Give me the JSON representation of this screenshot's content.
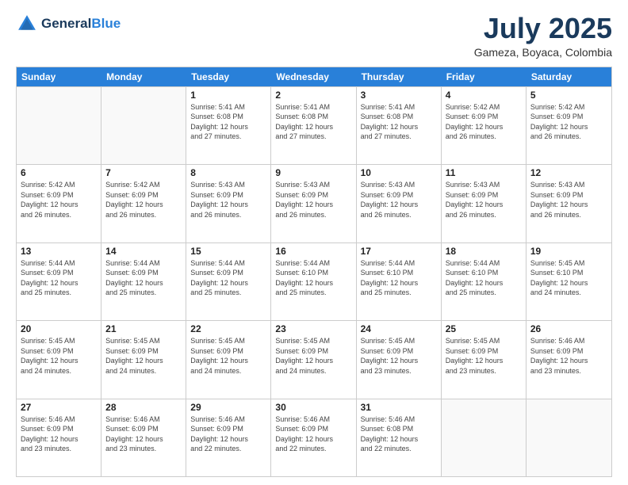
{
  "header": {
    "logo_line1": "General",
    "logo_line2": "Blue",
    "month_year": "July 2025",
    "location": "Gameza, Boyaca, Colombia"
  },
  "days_of_week": [
    "Sunday",
    "Monday",
    "Tuesday",
    "Wednesday",
    "Thursday",
    "Friday",
    "Saturday"
  ],
  "weeks": [
    [
      {
        "day": "",
        "empty": true,
        "info": ""
      },
      {
        "day": "",
        "empty": true,
        "info": ""
      },
      {
        "day": "1",
        "info": "Sunrise: 5:41 AM\nSunset: 6:08 PM\nDaylight: 12 hours\nand 27 minutes."
      },
      {
        "day": "2",
        "info": "Sunrise: 5:41 AM\nSunset: 6:08 PM\nDaylight: 12 hours\nand 27 minutes."
      },
      {
        "day": "3",
        "info": "Sunrise: 5:41 AM\nSunset: 6:08 PM\nDaylight: 12 hours\nand 27 minutes."
      },
      {
        "day": "4",
        "info": "Sunrise: 5:42 AM\nSunset: 6:09 PM\nDaylight: 12 hours\nand 26 minutes."
      },
      {
        "day": "5",
        "info": "Sunrise: 5:42 AM\nSunset: 6:09 PM\nDaylight: 12 hours\nand 26 minutes."
      }
    ],
    [
      {
        "day": "6",
        "info": "Sunrise: 5:42 AM\nSunset: 6:09 PM\nDaylight: 12 hours\nand 26 minutes."
      },
      {
        "day": "7",
        "info": "Sunrise: 5:42 AM\nSunset: 6:09 PM\nDaylight: 12 hours\nand 26 minutes."
      },
      {
        "day": "8",
        "info": "Sunrise: 5:43 AM\nSunset: 6:09 PM\nDaylight: 12 hours\nand 26 minutes."
      },
      {
        "day": "9",
        "info": "Sunrise: 5:43 AM\nSunset: 6:09 PM\nDaylight: 12 hours\nand 26 minutes."
      },
      {
        "day": "10",
        "info": "Sunrise: 5:43 AM\nSunset: 6:09 PM\nDaylight: 12 hours\nand 26 minutes."
      },
      {
        "day": "11",
        "info": "Sunrise: 5:43 AM\nSunset: 6:09 PM\nDaylight: 12 hours\nand 26 minutes."
      },
      {
        "day": "12",
        "info": "Sunrise: 5:43 AM\nSunset: 6:09 PM\nDaylight: 12 hours\nand 26 minutes."
      }
    ],
    [
      {
        "day": "13",
        "info": "Sunrise: 5:44 AM\nSunset: 6:09 PM\nDaylight: 12 hours\nand 25 minutes."
      },
      {
        "day": "14",
        "info": "Sunrise: 5:44 AM\nSunset: 6:09 PM\nDaylight: 12 hours\nand 25 minutes."
      },
      {
        "day": "15",
        "info": "Sunrise: 5:44 AM\nSunset: 6:09 PM\nDaylight: 12 hours\nand 25 minutes."
      },
      {
        "day": "16",
        "info": "Sunrise: 5:44 AM\nSunset: 6:10 PM\nDaylight: 12 hours\nand 25 minutes."
      },
      {
        "day": "17",
        "info": "Sunrise: 5:44 AM\nSunset: 6:10 PM\nDaylight: 12 hours\nand 25 minutes."
      },
      {
        "day": "18",
        "info": "Sunrise: 5:44 AM\nSunset: 6:10 PM\nDaylight: 12 hours\nand 25 minutes."
      },
      {
        "day": "19",
        "info": "Sunrise: 5:45 AM\nSunset: 6:10 PM\nDaylight: 12 hours\nand 24 minutes."
      }
    ],
    [
      {
        "day": "20",
        "info": "Sunrise: 5:45 AM\nSunset: 6:09 PM\nDaylight: 12 hours\nand 24 minutes."
      },
      {
        "day": "21",
        "info": "Sunrise: 5:45 AM\nSunset: 6:09 PM\nDaylight: 12 hours\nand 24 minutes."
      },
      {
        "day": "22",
        "info": "Sunrise: 5:45 AM\nSunset: 6:09 PM\nDaylight: 12 hours\nand 24 minutes."
      },
      {
        "day": "23",
        "info": "Sunrise: 5:45 AM\nSunset: 6:09 PM\nDaylight: 12 hours\nand 24 minutes."
      },
      {
        "day": "24",
        "info": "Sunrise: 5:45 AM\nSunset: 6:09 PM\nDaylight: 12 hours\nand 23 minutes."
      },
      {
        "day": "25",
        "info": "Sunrise: 5:45 AM\nSunset: 6:09 PM\nDaylight: 12 hours\nand 23 minutes."
      },
      {
        "day": "26",
        "info": "Sunrise: 5:46 AM\nSunset: 6:09 PM\nDaylight: 12 hours\nand 23 minutes."
      }
    ],
    [
      {
        "day": "27",
        "info": "Sunrise: 5:46 AM\nSunset: 6:09 PM\nDaylight: 12 hours\nand 23 minutes."
      },
      {
        "day": "28",
        "info": "Sunrise: 5:46 AM\nSunset: 6:09 PM\nDaylight: 12 hours\nand 23 minutes."
      },
      {
        "day": "29",
        "info": "Sunrise: 5:46 AM\nSunset: 6:09 PM\nDaylight: 12 hours\nand 22 minutes."
      },
      {
        "day": "30",
        "info": "Sunrise: 5:46 AM\nSunset: 6:09 PM\nDaylight: 12 hours\nand 22 minutes."
      },
      {
        "day": "31",
        "info": "Sunrise: 5:46 AM\nSunset: 6:08 PM\nDaylight: 12 hours\nand 22 minutes."
      },
      {
        "day": "",
        "empty": true,
        "info": ""
      },
      {
        "day": "",
        "empty": true,
        "info": ""
      }
    ]
  ]
}
